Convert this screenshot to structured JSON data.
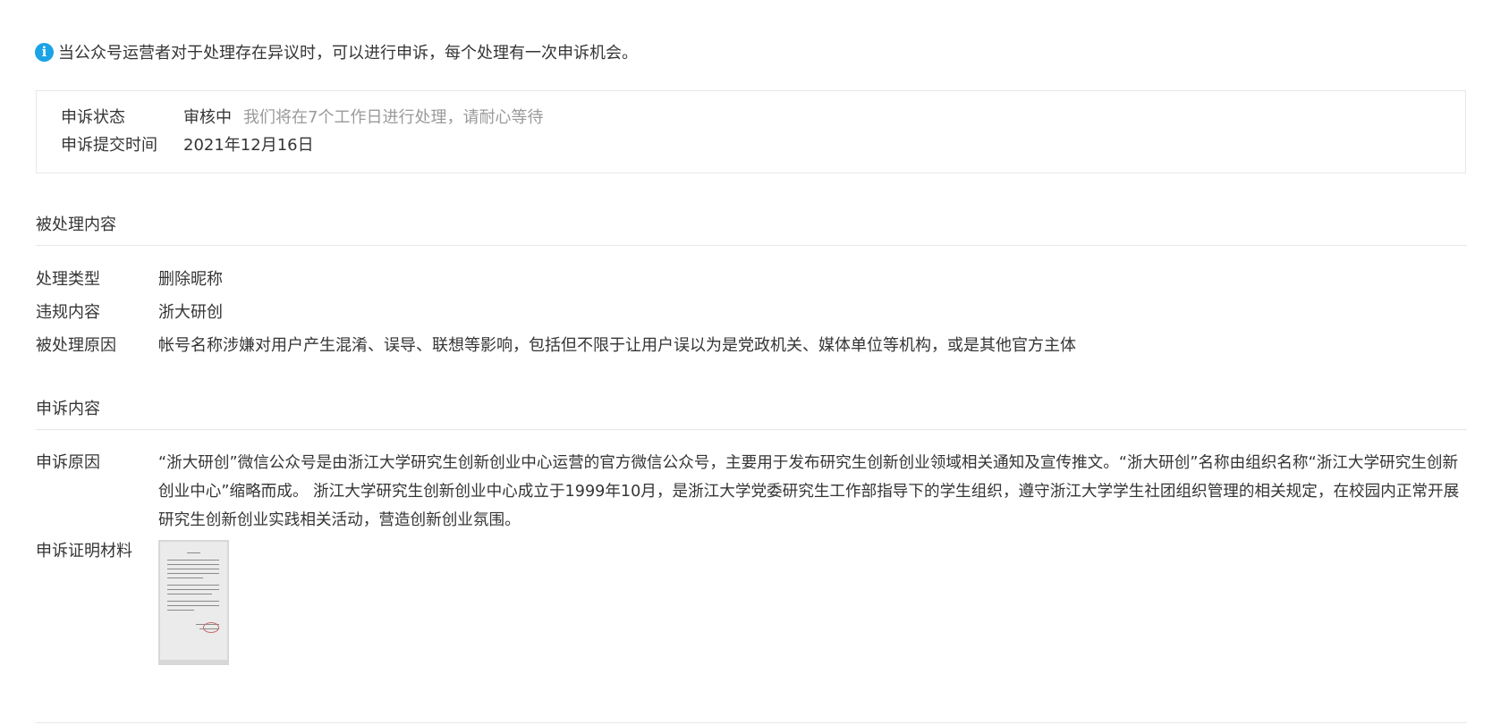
{
  "notice": {
    "icon": "info-icon",
    "text": "当公众号运营者对于处理存在异议时，可以进行申诉，每个处理有一次申诉机会。"
  },
  "status": {
    "state_label": "申诉状态",
    "state_value": "审核中",
    "state_hint": "我们将在7个工作日进行处理，请耐心等待",
    "time_label": "申诉提交时间",
    "time_value": "2021年12月16日"
  },
  "handled": {
    "title": "被处理内容",
    "type_label": "处理类型",
    "type_value": "删除昵称",
    "content_label": "违规内容",
    "content_value": "浙大研创",
    "reason_label": "被处理原因",
    "reason_value": "帐号名称涉嫌对用户产生混淆、误导、联想等影响，包括但不限于让用户误以为是党政机关、媒体单位等机构，或是其他官方主体"
  },
  "appeal": {
    "title": "申诉内容",
    "reason_label": "申诉原因",
    "reason_value": "“浙大研创”微信公众号是由浙江大学研究生创新创业中心运营的官方微信公众号，主要用于发布研究生创新创业领域相关通知及宣传推文。“浙大研创”名称由组织名称“浙江大学研究生创新创业中心”缩略而成。 浙江大学研究生创新创业中心成立于1999年10月，是浙江大学党委研究生工作部指导下的学生组织，遵守浙江大学学生社团组织管理的相关规定，在校园内正常开展研究生创新创业实践相关活动，营造创新创业氛围。",
    "evidence_label": "申诉证明材料"
  },
  "colors": {
    "accent": "#1aa3e6",
    "text": "#353535",
    "hint": "#9a9a9a",
    "border": "#e4e8eb"
  }
}
